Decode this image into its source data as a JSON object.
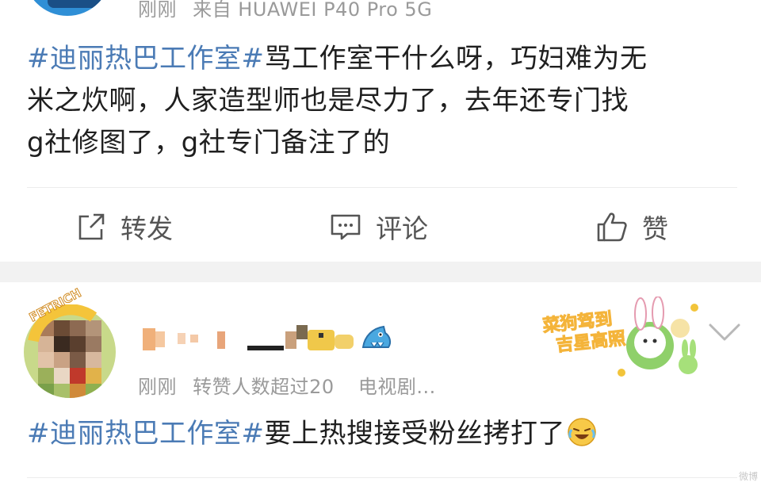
{
  "post1": {
    "meta": {
      "time": "刚刚",
      "source": "来自 HUAWEI P40 Pro 5G"
    },
    "hashtag": "#迪丽热巴工作室#",
    "text_lines": [
      "骂工作室干什么呀，巧妇难为无",
      "米之炊啊，人家造型师也是尽力了，去年还专门找",
      "g社修图了，g社专门备注了的"
    ],
    "actions": {
      "repost": "转发",
      "comment": "评论",
      "like": "赞"
    }
  },
  "post2": {
    "meta": {
      "time": "刚刚",
      "repost_count": "转赞人数超过20",
      "source": "电视剧..."
    },
    "hashtag": "#迪丽热巴工作室#",
    "text": "要上热搜接受粉丝拷打了",
    "avatar_badge": "FETRICH",
    "sticker_text": [
      "菜狗驾到",
      "吉星高照"
    ]
  },
  "watermark": "微博",
  "colors": {
    "hashtag": "#4b7bb5",
    "meta": "#9a9a9a",
    "separator": "#f2f2f2"
  }
}
